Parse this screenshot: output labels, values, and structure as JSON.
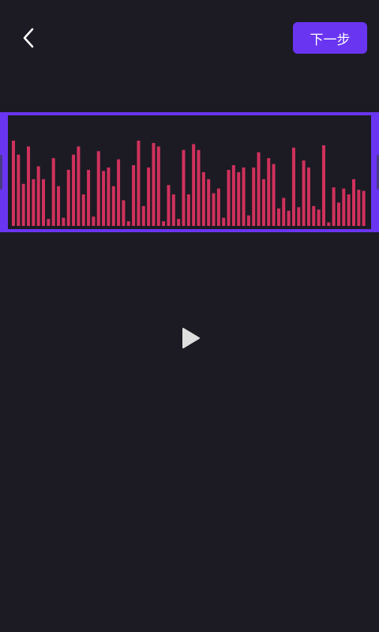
{
  "header": {
    "back_icon": "chevron-left-icon",
    "next_label": "下一步"
  },
  "colors": {
    "background": "#1c1b24",
    "accent": "#6a35f0",
    "waveform_bar": "#d0315c",
    "play_icon": "#dedede"
  },
  "waveform": {
    "levels": [
      0.73,
      0.61,
      0.36,
      0.68,
      0.4,
      0.51,
      0.4,
      0.06,
      0.58,
      0.34,
      0.07,
      0.48,
      0.61,
      0.68,
      0.27,
      0.48,
      0.08,
      0.64,
      0.47,
      0.5,
      0.34,
      0.57,
      0.22,
      0.04,
      0.52,
      0.73,
      0.17,
      0.5,
      0.71,
      0.68,
      0.04,
      0.35,
      0.27,
      0.06,
      0.65,
      0.27,
      0.7,
      0.65,
      0.46,
      0.4,
      0.28,
      0.32,
      0.07,
      0.48,
      0.52,
      0.46,
      0.5,
      0.09,
      0.5,
      0.63,
      0.4,
      0.58,
      0.53,
      0.15,
      0.24,
      0.13,
      0.67,
      0.16,
      0.56,
      0.5,
      0.17,
      0.14,
      0.69,
      0.03,
      0.33,
      0.2,
      0.32,
      0.27,
      0.4,
      0.31,
      0.3
    ]
  },
  "player": {
    "play_icon": "play-icon"
  }
}
